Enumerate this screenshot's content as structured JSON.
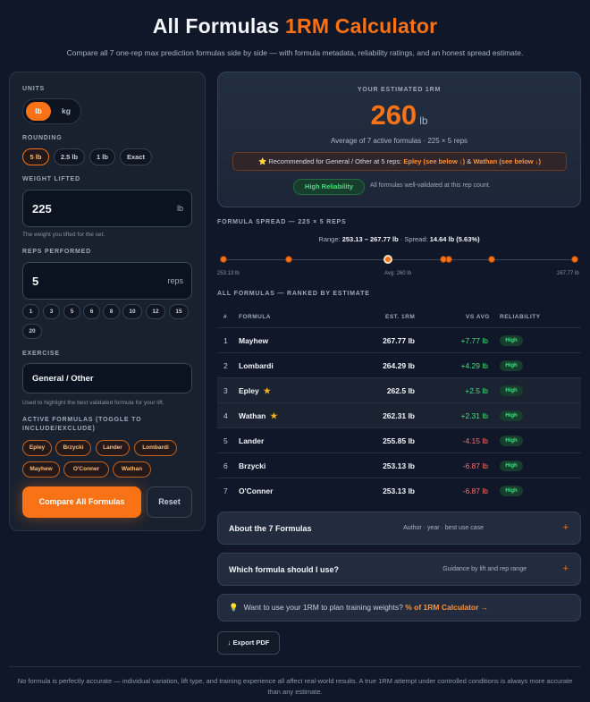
{
  "header": {
    "title_main": "All Formulas",
    "title_accent": "1RM Calculator",
    "subtitle": "Compare all 7 one-rep max prediction formulas side by side — with formula metadata, reliability ratings, and an honest spread estimate."
  },
  "sidebar": {
    "units": {
      "label": "UNITS",
      "options": [
        "lb",
        "kg"
      ],
      "selected": "lb"
    },
    "rounding": {
      "label": "ROUNDING",
      "options": [
        "5 lb",
        "2.5 lb",
        "1 lb",
        "Exact"
      ],
      "selected": "5 lb"
    },
    "weight": {
      "label": "WEIGHT LIFTED",
      "value": "225",
      "unit": "lb",
      "hint": "The weight you lifted for the set."
    },
    "reps": {
      "label": "REPS PERFORMED",
      "value": "5",
      "unit": "reps",
      "quick": [
        "1",
        "3",
        "5",
        "6",
        "8",
        "10",
        "12",
        "15",
        "20"
      ]
    },
    "exercise": {
      "label": "EXERCISE",
      "value": "General / Other",
      "hint": "Used to highlight the best validated formula for your lift."
    },
    "formulas": {
      "label_line1": "ACTIVE FORMULAS (TOGGLE TO",
      "label_line2": "INCLUDE/EXCLUDE)",
      "items": [
        "Epley",
        "Brzycki",
        "Lander",
        "Lombardi",
        "Mayhew",
        "O'Conner",
        "Wathan"
      ]
    },
    "compare_label": "Compare All Formulas",
    "reset_label": "Reset"
  },
  "result": {
    "label": "YOUR ESTIMATED 1RM",
    "value": "260",
    "unit": "lb",
    "avg_text": "Average of 7 active formulas · 225 × 5 reps",
    "rec_prefix": "⭐ Recommended for General / Other at 5 reps:",
    "rec_f1": "Epley",
    "rec_s1": "(see below ↓)",
    "rec_amp": "&",
    "rec_f2": "Wathan",
    "rec_s2": "(see below ↓)",
    "reliability_badge": "High Reliability",
    "reliability_note": "All formulas well-validated at this rep count."
  },
  "spread": {
    "label": "FORMULA SPREAD — 225 × 5 REPS",
    "range_label": "Range:",
    "range_value": "253.13 – 267.77 lb",
    "spread_label": "· Spread:",
    "spread_value": "14.64 lb (5.63%)",
    "min_label": "253.13 lb",
    "avg_label": "Avg: 260 lb",
    "max_label": "267.77 lb",
    "min": 253.13,
    "max": 267.77,
    "avg": 260,
    "points": [
      267.77,
      264.29,
      262.5,
      262.31,
      255.85,
      253.13,
      253.13
    ]
  },
  "table": {
    "label": "ALL FORMULAS — RANKED BY ESTIMATE",
    "headers": [
      "#",
      "FORMULA",
      "EST. 1RM",
      "VS AVG",
      "RELIABILITY"
    ],
    "rows": [
      {
        "rank": "1",
        "name": "Mayhew",
        "star": "",
        "est": "267.77 lb",
        "vs": "+7.77 lb",
        "rel": "High"
      },
      {
        "rank": "2",
        "name": "Lombardi",
        "star": "",
        "est": "264.29 lb",
        "vs": "+4.29 lb",
        "rel": "High"
      },
      {
        "rank": "3",
        "name": "Epley",
        "star": "★",
        "est": "262.5 lb",
        "vs": "+2.5 lb",
        "rel": "High"
      },
      {
        "rank": "4",
        "name": "Wathan",
        "star": "★",
        "est": "262.31 lb",
        "vs": "+2.31 lb",
        "rel": "High"
      },
      {
        "rank": "5",
        "name": "Lander",
        "star": "",
        "est": "255.85 lb",
        "vs": "-4.15 lb",
        "rel": "High"
      },
      {
        "rank": "6",
        "name": "Brzycki",
        "star": "",
        "est": "253.13 lb",
        "vs": "-6.87 lb",
        "rel": "High"
      },
      {
        "rank": "7",
        "name": "O'Conner",
        "star": "",
        "est": "253.13 lb",
        "vs": "-6.87 lb",
        "rel": "High"
      }
    ]
  },
  "accordions": [
    {
      "title": "About the 7 Formulas",
      "meta": "Author · year · best use case",
      "icon": "+"
    },
    {
      "title": "Which formula should I use?",
      "meta": "Guidance by lift and rep range",
      "icon": "+"
    }
  ],
  "tip": {
    "icon": "💡",
    "text": "Want to use your 1RM to plan training weights?",
    "link": "% of 1RM Calculator →"
  },
  "export_label": "↓ Export PDF",
  "footer": "No formula is perfectly accurate — individual variation, lift type, and training experience all affect real-world results. A true 1RM attempt under controlled conditions is always more accurate than any estimate.",
  "colors": {
    "accent": "#f97316",
    "positive": "#4ade80",
    "negative": "#f87171",
    "background": "#0f1728"
  }
}
